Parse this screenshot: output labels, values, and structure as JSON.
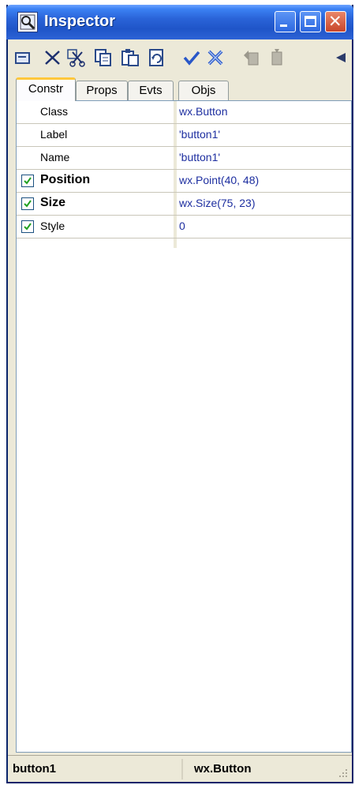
{
  "window": {
    "title": "Inspector",
    "close_glyph": "✕"
  },
  "toolbar": {
    "icons": [
      "folder-icon",
      "delete-icon",
      "cut-icon",
      "copy-icon",
      "paste-icon",
      "refresh-icon",
      "check-icon",
      "cancel-icon",
      "move-up-icon",
      "move-down-icon",
      "arrow-icon"
    ]
  },
  "tabs": [
    {
      "label": "Constr",
      "active": true
    },
    {
      "label": "Props",
      "active": false
    },
    {
      "label": "Evts",
      "active": false
    },
    {
      "label": "Objs",
      "active": false
    }
  ],
  "properties": [
    {
      "name": "Class",
      "value": "wx.Button",
      "checkbox": false,
      "bold": false
    },
    {
      "name": "Label",
      "value": "'button1'",
      "checkbox": false,
      "bold": false
    },
    {
      "name": "Name",
      "value": "'button1'",
      "checkbox": false,
      "bold": false
    },
    {
      "name": "Position",
      "value": "wx.Point(40, 48)",
      "checkbox": true,
      "bold": true
    },
    {
      "name": "Size",
      "value": "wx.Size(75, 23)",
      "checkbox": true,
      "bold": true
    },
    {
      "name": "Style",
      "value": "0",
      "checkbox": true,
      "bold": false
    }
  ],
  "status": {
    "object_name": "button1",
    "object_class": "wx.Button"
  },
  "colors": {
    "titlebar": "#2a63d8",
    "window_bg": "#ece9d8",
    "value_text": "#1e2fa0",
    "check": "#21a121"
  }
}
